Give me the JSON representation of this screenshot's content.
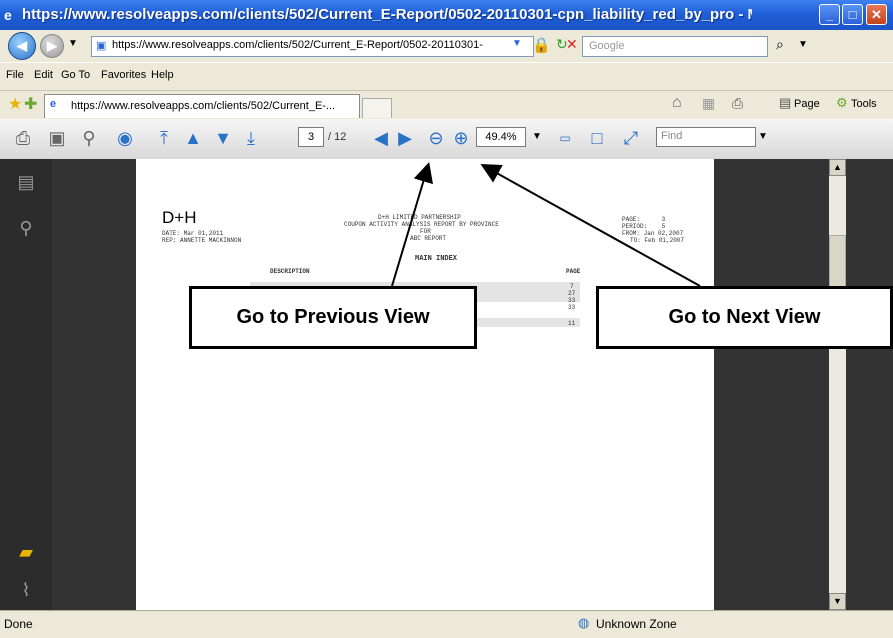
{
  "window": {
    "title": "https://www.resolveapps.com/clients/502/Current_E-Report/0502-20110301-cpn_liability_red_by_pro - Microsoft I..."
  },
  "navigation": {
    "address": "https://www.resolveapps.com/clients/502/Current_E-Report/0502-20110301-",
    "search_placeholder": "Google"
  },
  "menu": {
    "items": [
      "File",
      "Edit",
      "Go To",
      "Favorites",
      "Help"
    ]
  },
  "favorites_bar": {
    "tab_title": "https://www.resolveapps.com/clients/502/Current_E-...",
    "page_label": "Page",
    "tools_label": "Tools"
  },
  "pdf_toolbar": {
    "page_number": "3",
    "page_total": "/ 12",
    "zoom": "49.4%",
    "find_placeholder": "Find"
  },
  "document": {
    "logo": "D+H",
    "header_left": [
      "DATE: Mar 01,2011",
      "REP: ANNETTE MACKINNON"
    ],
    "header_center": [
      "D+H LIMITED PARTNERSHIP",
      "COUPON ACTIVITY ANALYSIS REPORT BY PROVINCE",
      "FOR",
      "ABC REPORT"
    ],
    "header_right": [
      "PAGE:      3",
      "PERIOD:    5",
      "FROM: Jan 02,2007",
      "TO: Feb 01,2007"
    ],
    "index_title": "MAIN INDEX",
    "col_description": "DESCRIPTION",
    "col_page": "PAGE",
    "page_refs": [
      "7",
      "27",
      "33",
      "33",
      "11"
    ]
  },
  "callouts": {
    "previous": "Go to Previous View",
    "next": "Go to Next View"
  },
  "status": {
    "text": "Done",
    "zone": "Unknown Zone"
  }
}
